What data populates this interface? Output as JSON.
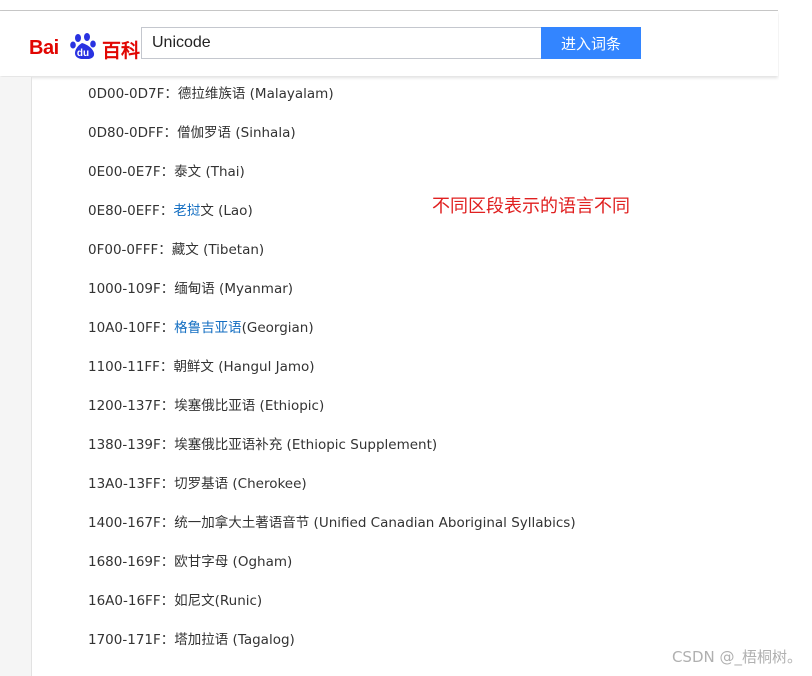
{
  "header": {
    "logo_bai": "Bai",
    "logo_du": "du",
    "logo_baike": "百科",
    "search_value": "Unicode",
    "search_button": "进入词条"
  },
  "colors": {
    "brand_red": "#e10602",
    "button_blue": "#3385ff",
    "link_blue": "#136ec2",
    "annotation_red": "#e02020"
  },
  "entries": [
    {
      "range": "0D00-0D7F：",
      "pre": "",
      "link": "",
      "name": "德拉维族语 (Malayalam)"
    },
    {
      "range": "0D80-0DFF：",
      "pre": "",
      "link": "",
      "name": "僧伽罗语 (Sinhala)"
    },
    {
      "range": "0E00-0E7F：",
      "pre": "",
      "link": "",
      "name": "泰文 (Thai)"
    },
    {
      "range": "0E80-0EFF：",
      "pre": "",
      "link": "老挝",
      "name": "文 (Lao)"
    },
    {
      "range": "0F00-0FFF：",
      "pre": "",
      "link": "",
      "name": "藏文 (Tibetan)"
    },
    {
      "range": "1000-109F：",
      "pre": "",
      "link": "",
      "name": "缅甸语 (Myanmar)"
    },
    {
      "range": "10A0-10FF：",
      "pre": "",
      "link": "格鲁吉亚语",
      "name": "(Georgian)"
    },
    {
      "range": "1100-11FF：",
      "pre": "",
      "link": "",
      "name": "朝鲜文 (Hangul Jamo)"
    },
    {
      "range": "1200-137F：",
      "pre": "",
      "link": "",
      "name": "埃塞俄比亚语 (Ethiopic)"
    },
    {
      "range": "1380-139F：",
      "pre": "",
      "link": "",
      "name": "埃塞俄比亚语补充 (Ethiopic Supplement)"
    },
    {
      "range": "13A0-13FF：",
      "pre": "",
      "link": "",
      "name": "切罗基语 (Cherokee)"
    },
    {
      "range": "1400-167F：",
      "pre": "",
      "link": "",
      "name": "统一加拿大土著语音节 (Unified Canadian Aboriginal Syllabics)"
    },
    {
      "range": "1680-169F：",
      "pre": "",
      "link": "",
      "name": "欧甘字母 (Ogham)"
    },
    {
      "range": "16A0-16FF：",
      "pre": "",
      "link": "",
      "name": "如尼文(Runic)"
    },
    {
      "range": "1700-171F：",
      "pre": "",
      "link": "",
      "name": "塔加拉语 (Tagalog)"
    }
  ],
  "annotation": "不同区段表示的语言不同",
  "watermark": "CSDN @_梧桐树。"
}
